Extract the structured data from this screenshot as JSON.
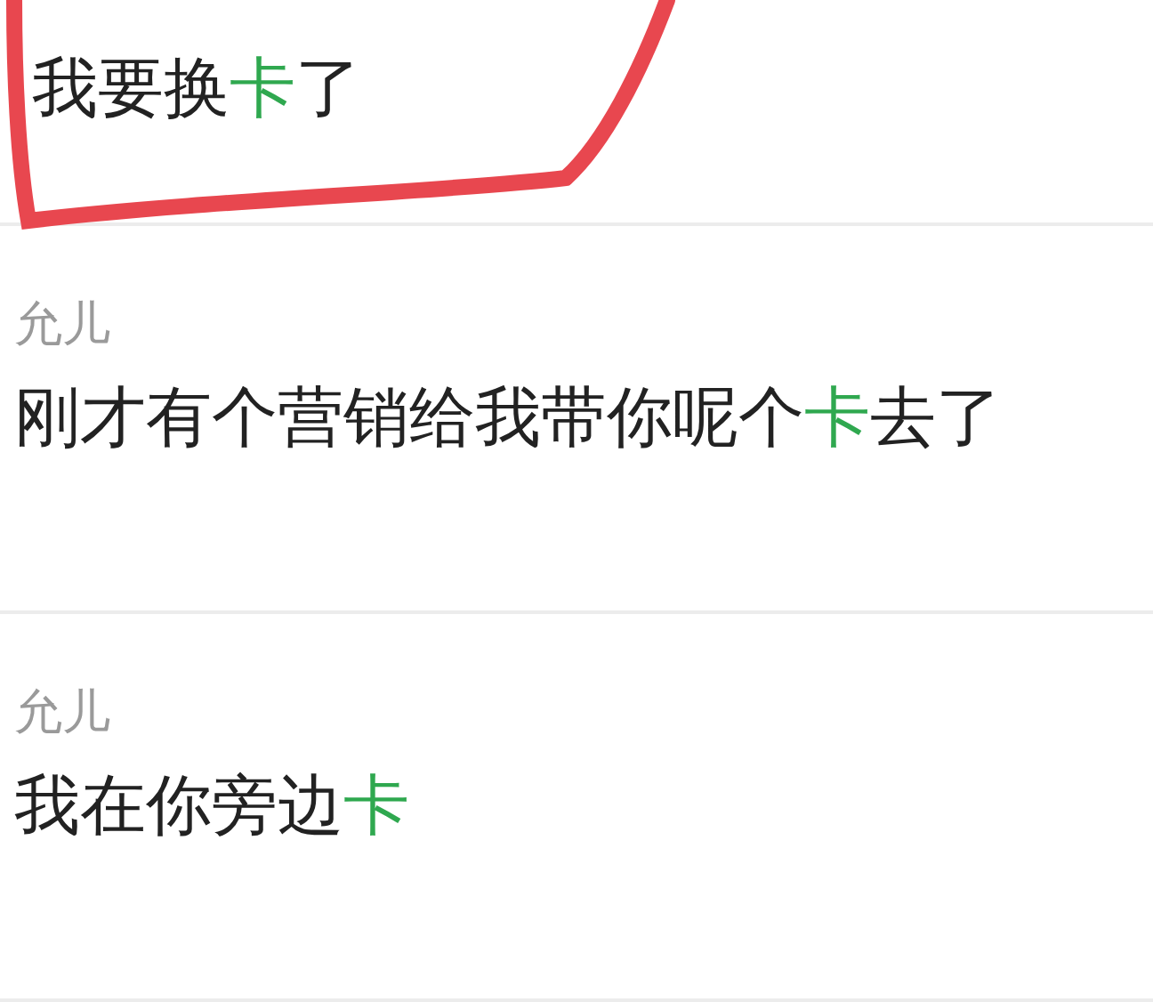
{
  "results": [
    {
      "segments": [
        {
          "text": "我要换",
          "highlight": false
        },
        {
          "text": "卡",
          "highlight": true
        },
        {
          "text": "了",
          "highlight": false
        }
      ],
      "circled": true
    },
    {
      "name": "允儿",
      "segments": [
        {
          "text": "刚才有个营销给我带你呢个",
          "highlight": false
        },
        {
          "text": "卡",
          "highlight": true
        },
        {
          "text": "去了",
          "highlight": false
        }
      ]
    },
    {
      "name": "允儿",
      "segments": [
        {
          "text": "我在你旁边",
          "highlight": false
        },
        {
          "text": "卡",
          "highlight": true
        }
      ]
    }
  ]
}
